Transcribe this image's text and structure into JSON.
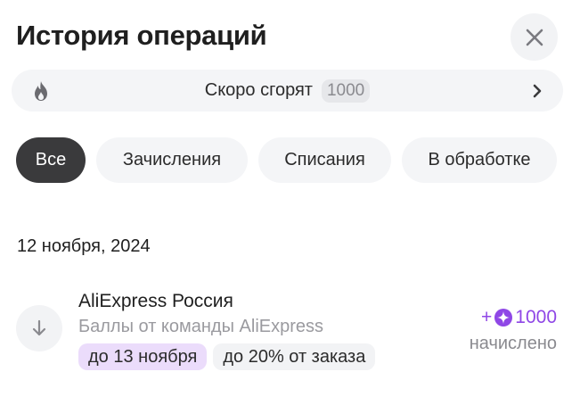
{
  "header": {
    "title": "История операций",
    "close_icon": "close-icon"
  },
  "burn_bar": {
    "icon": "flame-icon",
    "text": "Скоро сгорят",
    "amount": "1000",
    "chevron_icon": "chevron-right-icon"
  },
  "filters": [
    {
      "label": "Все",
      "active": true
    },
    {
      "label": "Зачисления",
      "active": false
    },
    {
      "label": "Списания",
      "active": false
    },
    {
      "label": "В обработке",
      "active": false
    }
  ],
  "groups": [
    {
      "date": "12 ноября, 2024",
      "operations": [
        {
          "icon": "arrow-down-icon",
          "merchant": "AliExpress Россия",
          "description": "Баллы от команды AliExpress",
          "tags": [
            "до 13 ноября",
            "до 20% от заказа"
          ],
          "sign": "+",
          "amount": "1000",
          "coin_icon": "points-coin-icon",
          "status": "начислено"
        }
      ]
    }
  ],
  "colors": {
    "accent": "#8f47e6",
    "tag_date_bg": "#ebdcfb",
    "chip_active_bg": "#3a3a3c",
    "surface": "#f4f5f7"
  }
}
